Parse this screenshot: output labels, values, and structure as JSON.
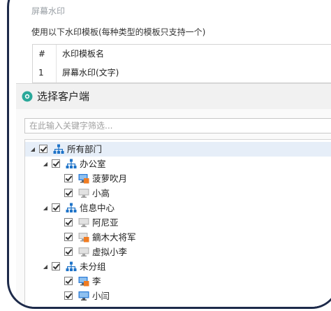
{
  "template_panel": {
    "section_title_fragment": "屏幕水印",
    "hint": "使用以下水印模板(每种类型的模板只支持一个)",
    "columns": [
      "#",
      "水印模板名"
    ],
    "rows": [
      {
        "no": "1",
        "name": "屏幕水印(文字)"
      }
    ]
  },
  "client_selector": {
    "title": "选择客户端",
    "search_placeholder": "在此输入关键字筛选...",
    "tree": {
      "root": {
        "label": "所有部门",
        "groups": [
          {
            "label": "办公室",
            "clients": [
              {
                "label": "菠萝吹月",
                "status": "warning"
              },
              {
                "label": "小高",
                "status": "offline"
              }
            ]
          },
          {
            "label": "信息中心",
            "clients": [
              {
                "label": "阿尼亚",
                "status": "offline"
              },
              {
                "label": "鏑木大将军",
                "status": "warning"
              },
              {
                "label": "虚拟小李",
                "status": "offline"
              }
            ]
          },
          {
            "label": "未分组",
            "clients": [
              {
                "label": "李",
                "status": "warning"
              },
              {
                "label": "小闫",
                "status": "online"
              }
            ]
          }
        ]
      }
    }
  },
  "colors": {
    "frame_border": "#1d2a4a",
    "org_icon": "#1e73c8",
    "client_online": "#2b7bd6",
    "client_offline": "#b9b9b9",
    "client_warning": "#f07c22",
    "header_icon": "#2aa89a"
  }
}
